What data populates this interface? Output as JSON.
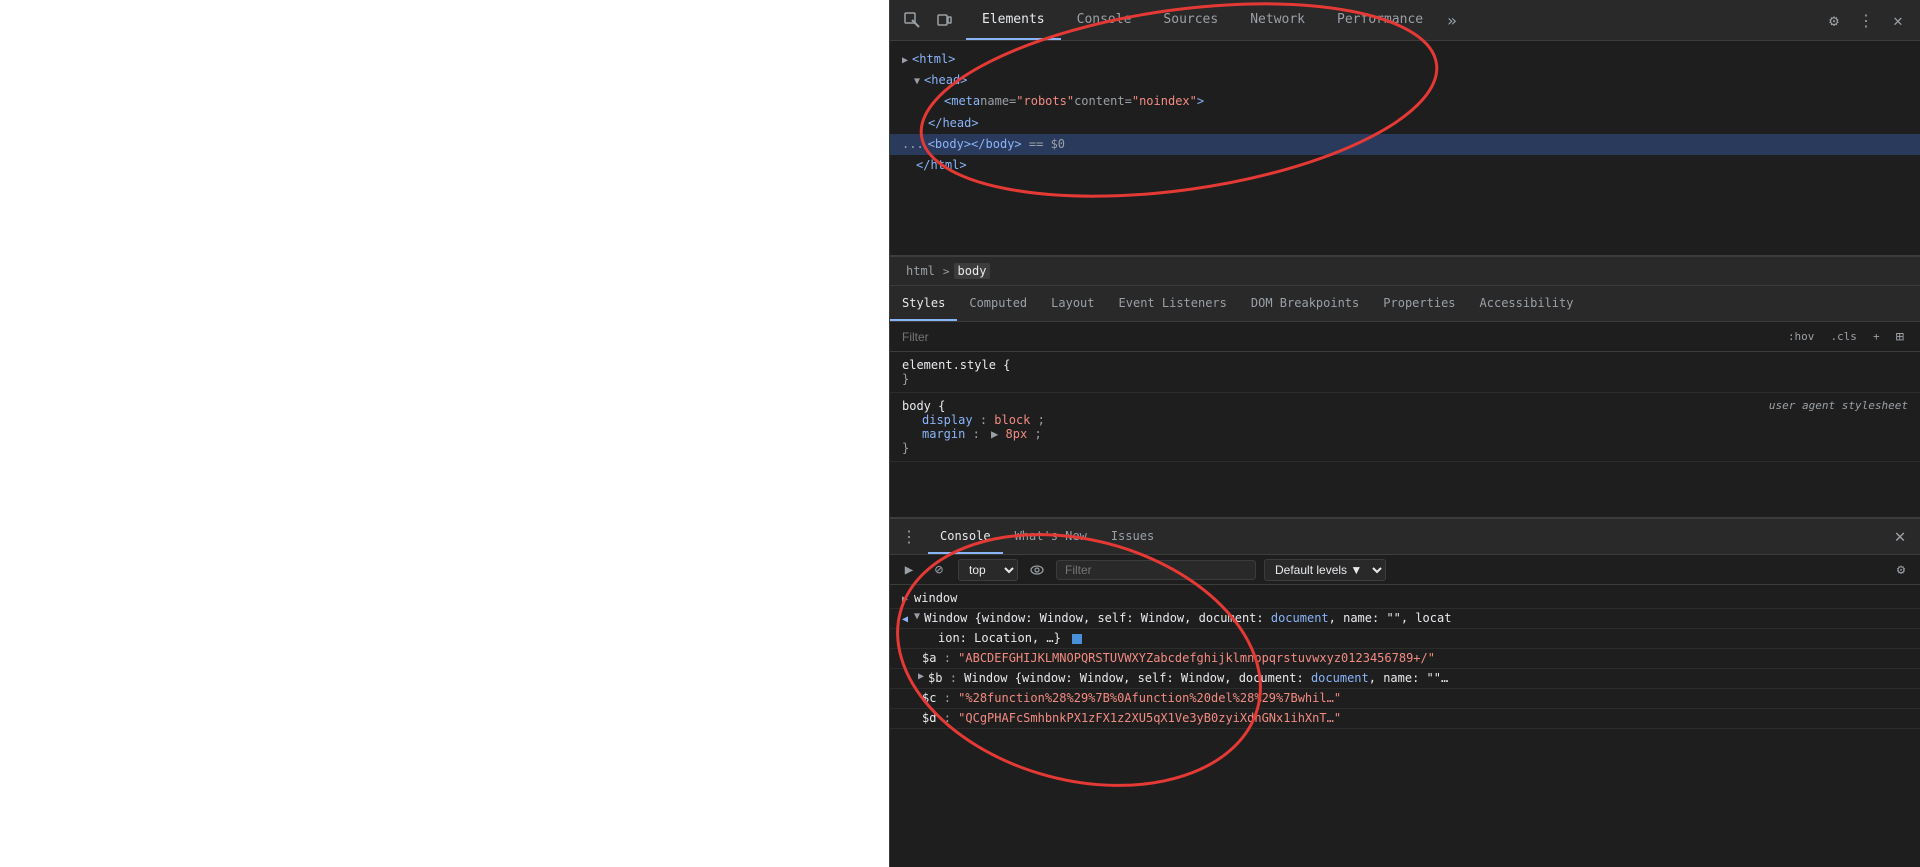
{
  "main": {
    "background": "#ffffff"
  },
  "devtools": {
    "toolbar": {
      "inspect_icon": "⬚",
      "device_icon": "▣",
      "more_icon": "»",
      "settings_icon": "⚙",
      "menu_icon": "⋮",
      "close_icon": "✕"
    },
    "tabs": [
      {
        "id": "elements",
        "label": "Elements",
        "active": true
      },
      {
        "id": "console",
        "label": "Console",
        "active": false
      },
      {
        "id": "sources",
        "label": "Sources",
        "active": false
      },
      {
        "id": "network",
        "label": "Network",
        "active": false
      },
      {
        "id": "performance",
        "label": "Performance",
        "active": false
      }
    ],
    "dom_tree": {
      "lines": [
        {
          "id": "html-open",
          "indent": 0,
          "content": "<html>",
          "type": "tag"
        },
        {
          "id": "head-open",
          "indent": 1,
          "content": "▼<head>",
          "type": "tag"
        },
        {
          "id": "meta",
          "indent": 2,
          "content": "<meta name=\"robots\" content=\"noindex\">",
          "type": "tag"
        },
        {
          "id": "head-close",
          "indent": 1,
          "content": "</head>",
          "type": "tag"
        },
        {
          "id": "body",
          "indent": 0,
          "content": "... <body></body> == $0",
          "type": "selected"
        },
        {
          "id": "html-close",
          "indent": 0,
          "content": "</html>",
          "type": "tag"
        }
      ]
    },
    "breadcrumb": {
      "items": [
        {
          "id": "html",
          "label": "html",
          "active": false
        },
        {
          "id": "body",
          "label": "body",
          "active": true
        }
      ]
    },
    "styles_tabs": [
      {
        "id": "styles",
        "label": "Styles",
        "active": true
      },
      {
        "id": "computed",
        "label": "Computed",
        "active": false
      },
      {
        "id": "layout",
        "label": "Layout",
        "active": false
      },
      {
        "id": "event-listeners",
        "label": "Event Listeners",
        "active": false
      },
      {
        "id": "dom-breakpoints",
        "label": "DOM Breakpoints",
        "active": false
      },
      {
        "id": "properties",
        "label": "Properties",
        "active": false
      },
      {
        "id": "accessibility",
        "label": "Accessibility",
        "active": false
      }
    ],
    "filter": {
      "placeholder": "Filter",
      "hov_label": ":hov",
      "cls_label": ".cls",
      "plus_label": "+",
      "sidebar_label": "⊞"
    },
    "styles_rules": [
      {
        "id": "element-style",
        "selector": "element.style {",
        "close": "}",
        "properties": []
      },
      {
        "id": "body-rule",
        "selector": "body {",
        "source": "user agent stylesheet",
        "close": "}",
        "properties": [
          {
            "name": "display",
            "value": "block"
          },
          {
            "name": "margin",
            "value": "▶ 8px"
          }
        ]
      }
    ],
    "console_panel": {
      "tabs": [
        {
          "id": "console",
          "label": "Console",
          "active": true
        },
        {
          "id": "whats-new",
          "label": "What's New",
          "active": false
        },
        {
          "id": "issues",
          "label": "Issues",
          "active": false
        }
      ],
      "toolbar": {
        "clear_btn": "🚫",
        "stop_btn": "⊘",
        "context_value": "top",
        "eye_icon": "👁",
        "filter_placeholder": "Filter",
        "default_levels": "Default levels",
        "settings_icon": "⚙"
      },
      "output": [
        {
          "id": "window-line",
          "arrow": "▶",
          "text": "window"
        },
        {
          "id": "window-expand",
          "arrow": "◀",
          "text": "Window {window: Window, self: Window, document: ",
          "link": "document",
          "text2": ", name: \"\", locat",
          "newline": "ion: Location, …} ",
          "square": "■"
        },
        {
          "id": "dollar-a",
          "indent": true,
          "text": "$a: \"ABCDEFGHIJKLMNOPQRSTUVWXYZabcdefghijklmnopqrstuvwxyz0123456789+/\""
        },
        {
          "id": "dollar-b",
          "indent": true,
          "arrow": "▶",
          "text": "$b: Window {window: Window, self: Window, document: ",
          "link": "document",
          "text2": ", name: \"\"…"
        },
        {
          "id": "dollar-c",
          "indent": true,
          "text": "$c: \"%28function%28%29%7B%0Afunction%20del%28%29%7Bwhil…\""
        },
        {
          "id": "dollar-d",
          "indent": true,
          "text": "$d: \"QCgPHAFcSmhbnkPX1zFX1z2XU5qX1Ve3yB0zyiXdnGNx1ihXnT…\""
        }
      ]
    }
  }
}
